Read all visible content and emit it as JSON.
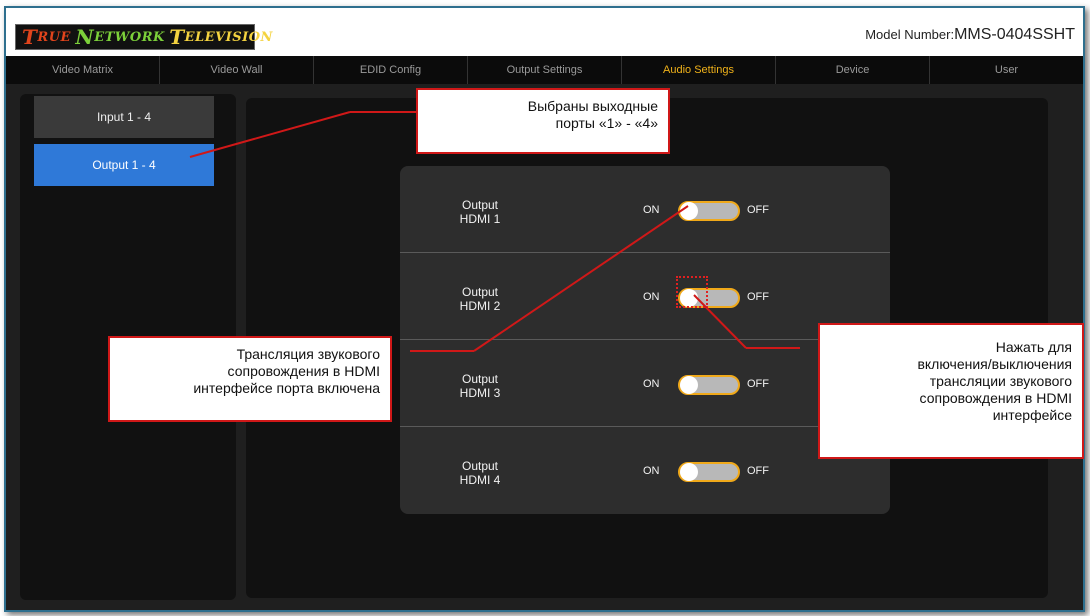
{
  "header": {
    "logo": {
      "w1_first": "T",
      "w1_rest": "RUE",
      "w2_first": "N",
      "w2_rest": "ETWORK",
      "w3_first": "T",
      "w3_rest": "ELEVISION"
    },
    "model_label": "Model Number:",
    "model_value": "MMS-0404SSHT"
  },
  "nav": {
    "tabs": [
      {
        "label": "Video Matrix"
      },
      {
        "label": "Video Wall"
      },
      {
        "label": "EDID Config"
      },
      {
        "label": "Output Settings"
      },
      {
        "label": "Audio Settings",
        "active": true
      },
      {
        "label": "Device"
      },
      {
        "label": "User"
      }
    ]
  },
  "sidebar": {
    "items": [
      {
        "label": "Input 1 - 4"
      },
      {
        "label": "Output 1 - 4",
        "selected": true
      }
    ]
  },
  "audio_rows": [
    {
      "label_line1": "Output",
      "label_line2": "HDMI 1",
      "on_label": "ON",
      "off_label": "OFF",
      "audio_enabled": true
    },
    {
      "label_line1": "Output",
      "label_line2": "HDMI 2",
      "on_label": "ON",
      "off_label": "OFF",
      "audio_enabled": true
    },
    {
      "label_line1": "Output",
      "label_line2": "HDMI 3",
      "on_label": "ON",
      "off_label": "OFF",
      "audio_enabled": true
    },
    {
      "label_line1": "Output",
      "label_line2": "HDMI 4",
      "on_label": "ON",
      "off_label": "OFF",
      "audio_enabled": true
    }
  ],
  "callouts": {
    "ports_selected": {
      "line1": "Выбраны выходные",
      "line2": "порты «1» - «4»"
    },
    "audio_enabled": {
      "line1": "Трансляция звукового",
      "line2": "сопровождения в HDMI",
      "line3": "интерфейсе порта включена"
    },
    "toggle_hint": {
      "line1": "Нажать для",
      "line2": "включения/выключения",
      "line3": "трансляции звукового",
      "line4": "сопровождения в HDMI",
      "line5": "интерфейсе"
    }
  },
  "colors": {
    "accent_active_tab": "#f0b21a",
    "selected_button": "#2f79d8",
    "toggle_border": "#f0a91a",
    "annotation_red": "#d01818"
  }
}
